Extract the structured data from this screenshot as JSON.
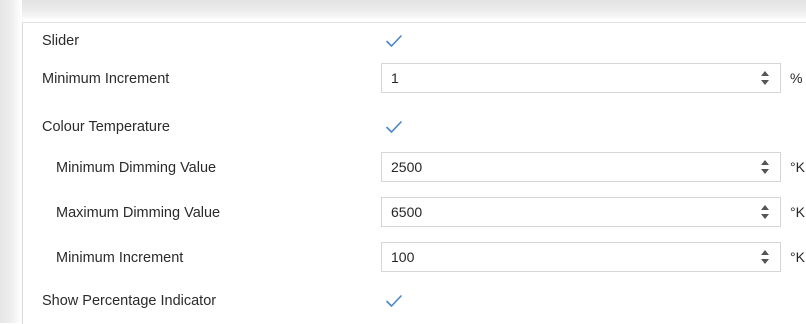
{
  "settings": {
    "slider": {
      "label": "Slider",
      "checked": true
    },
    "min_increment": {
      "label": "Minimum Increment",
      "value": "1",
      "unit": "%"
    },
    "colour_temperature": {
      "label": "Colour Temperature",
      "checked": true
    },
    "min_dimming": {
      "label": "Minimum Dimming Value",
      "value": "2500",
      "unit": "°K"
    },
    "max_dimming": {
      "label": "Maximum Dimming Value",
      "value": "6500",
      "unit": "°K"
    },
    "ct_min_increment": {
      "label": "Minimum Increment",
      "value": "100",
      "unit": "°K"
    },
    "show_percentage": {
      "label": "Show Percentage Indicator",
      "checked": true
    }
  },
  "icons": {
    "checkmark": "checkmark-icon",
    "spinner_up": "spinner-up-icon",
    "spinner_down": "spinner-down-icon"
  },
  "colors": {
    "checkmark": "#4a86c8",
    "field_border": "#d6d6d6"
  }
}
